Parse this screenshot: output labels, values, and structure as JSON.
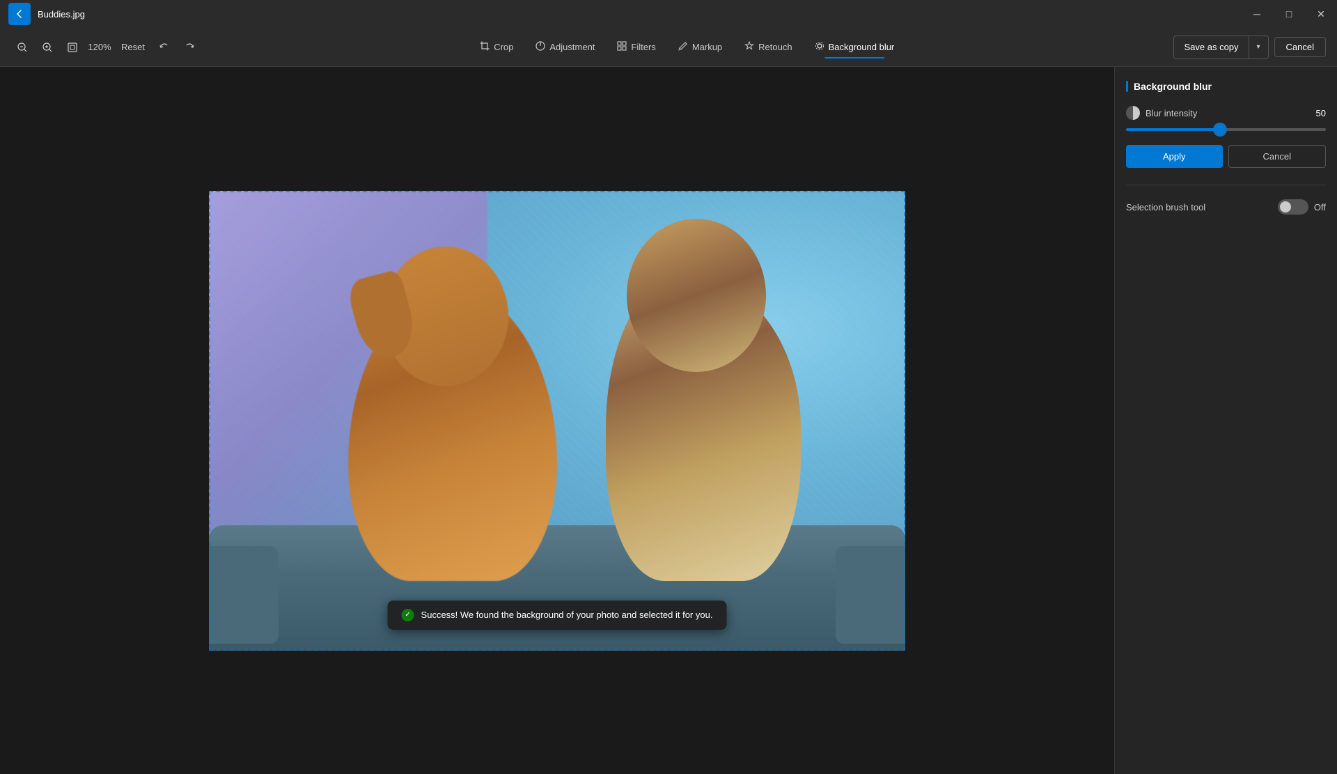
{
  "titleBar": {
    "filename": "Buddies.jpg",
    "minimize": "─",
    "maximize": "□",
    "close": "✕"
  },
  "toolbar": {
    "zoomLevel": "120%",
    "resetLabel": "Reset",
    "tools": [
      {
        "id": "crop",
        "label": "Crop",
        "icon": "⊡"
      },
      {
        "id": "adjustment",
        "label": "Adjustment",
        "icon": "◐"
      },
      {
        "id": "filters",
        "label": "Filters",
        "icon": "▦"
      },
      {
        "id": "markup",
        "label": "Markup",
        "icon": "✏"
      },
      {
        "id": "retouch",
        "label": "Retouch",
        "icon": "✦"
      },
      {
        "id": "backgroundblur",
        "label": "Background blur",
        "icon": "⊛"
      }
    ],
    "activeTool": "backgroundblur",
    "saveAsCopy": "Save as copy",
    "cancel": "Cancel"
  },
  "rightPanel": {
    "title": "Background blur",
    "blurIntensity": {
      "label": "Blur intensity",
      "value": 50,
      "min": 0,
      "max": 100,
      "fillPercent": 47
    },
    "applyLabel": "Apply",
    "cancelLabel": "Cancel",
    "selectionBrush": {
      "label": "Selection brush tool",
      "state": "Off"
    }
  },
  "toast": {
    "message": "Success! We found the background of your photo and selected it for you."
  }
}
